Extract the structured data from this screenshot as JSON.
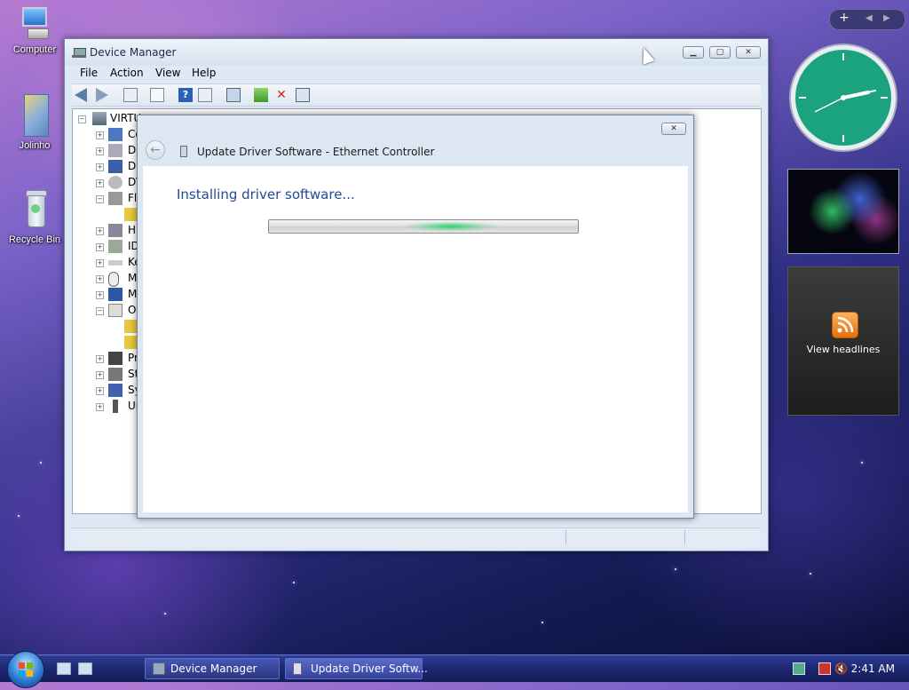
{
  "desktop": {
    "icons": [
      {
        "label": "Computer"
      },
      {
        "label": "Jolinho"
      },
      {
        "label": "Recycle Bin"
      }
    ]
  },
  "device_manager": {
    "title": "Device Manager",
    "menu": [
      "File",
      "Action",
      "View",
      "Help"
    ],
    "tree": {
      "root": "VIRTU",
      "items": [
        "Co",
        "Di",
        "Di",
        "DV",
        "Fl",
        "",
        "H",
        "ID",
        "Ke",
        "M",
        "M",
        "Ot",
        "",
        "",
        "Pr",
        "St",
        "Sy",
        "Ur"
      ]
    }
  },
  "update_dialog": {
    "title": "Update Driver Software - Ethernet Controller",
    "heading": "Installing driver software...",
    "progress_indeterminate": true
  },
  "gadgets": {
    "feed_label": "View headlines",
    "clock_time": "2:41"
  },
  "taskbar": {
    "buttons": [
      "Device Manager",
      "Update Driver Softw..."
    ],
    "clock": "2:41 AM"
  },
  "colors": {
    "accent_heading": "#1f4a96",
    "progress_glow": "#28d26e",
    "taskbar": "#1d2770"
  }
}
